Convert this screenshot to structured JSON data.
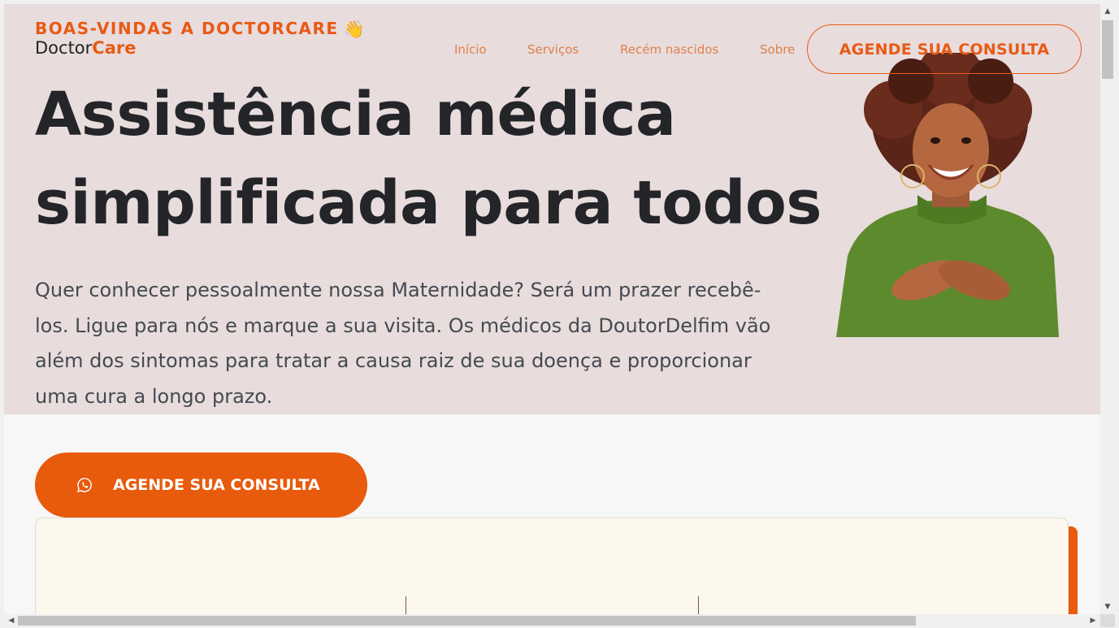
{
  "header": {
    "welcome": "BOAS-VINDAS A DOCTORCARE",
    "welcome_emoji": "👋",
    "logo_part1": "Doctor",
    "logo_part2": "Care"
  },
  "nav": {
    "items": [
      {
        "label": "Início"
      },
      {
        "label": "Serviços"
      },
      {
        "label": "Recém nascidos"
      },
      {
        "label": "Sobre"
      }
    ],
    "cta_label": "AGENDE SUA CONSULTA"
  },
  "hero": {
    "title_line1": "Assistência médica",
    "title_line2": "simplificada para todos",
    "description": "Quer conhecer pessoalmente nossa Maternidade? Será um prazer recebê-los. Ligue para nós e marque a sua visita. Os médicos da DoutorDelfim vão além dos sintomas para tratar a causa raiz de sua doença e proporcionar uma cura a longo prazo.",
    "cta_label": "AGENDE SUA CONSULTA",
    "cta_icon": "whatsapp-icon"
  },
  "colors": {
    "accent": "#e85a0c",
    "hero_bg": "#e8dcdd",
    "page_bg": "#f6f7f6",
    "card_bg": "#fdf8ee",
    "title": "#232529"
  }
}
